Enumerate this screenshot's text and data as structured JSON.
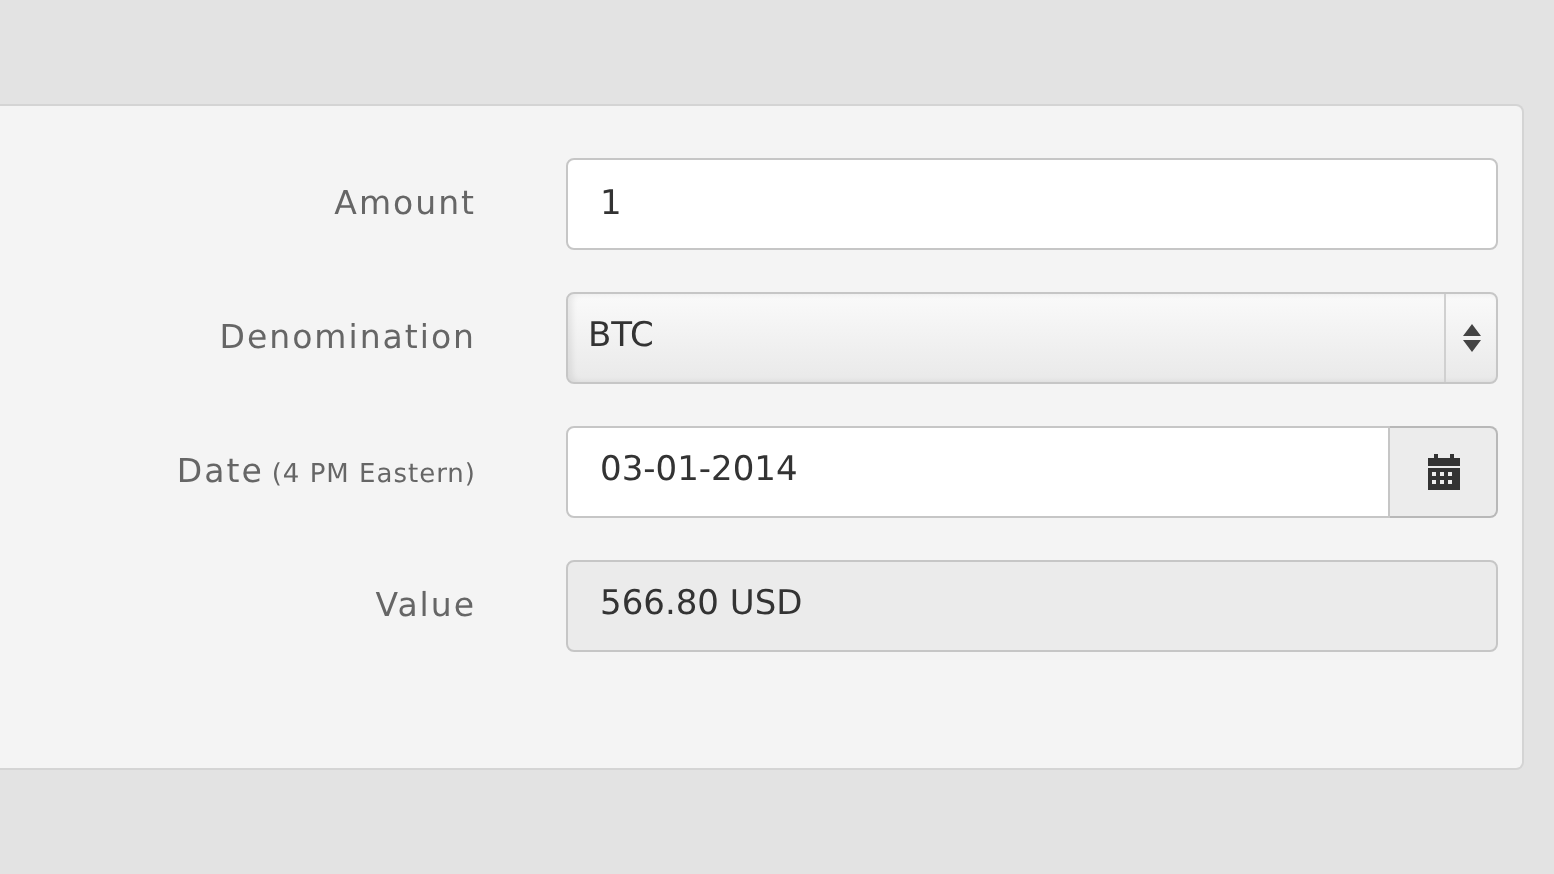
{
  "fields": [
    {
      "kind": "text",
      "label": "Amount",
      "value": "1"
    },
    {
      "kind": "select",
      "label": "Denomination",
      "value": "BTC"
    },
    {
      "kind": "date",
      "label": "Date",
      "note": "(4 PM Eastern)",
      "value": "03-01-2014"
    },
    {
      "kind": "readonly",
      "label": "Value",
      "value": "566.80 USD"
    }
  ]
}
